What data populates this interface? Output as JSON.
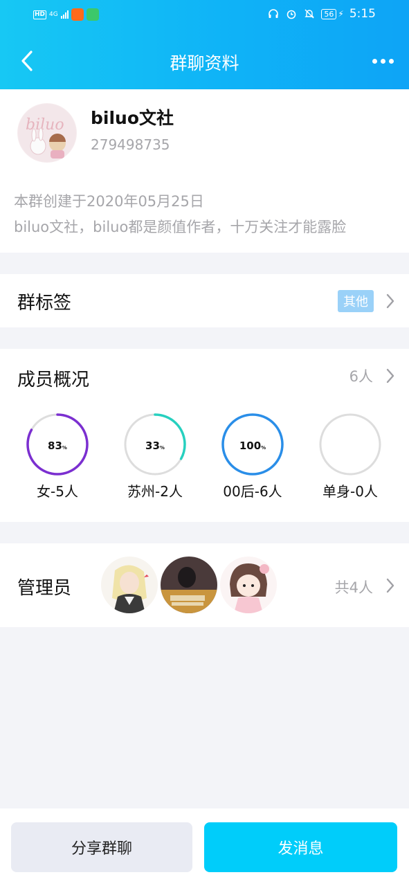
{
  "status_bar": {
    "left_badges": [
      "HD",
      "4G"
    ],
    "time": "5:15",
    "battery": "56"
  },
  "nav": {
    "title": "群聊资料",
    "back_icon": "chevron-left-icon",
    "more_icon": "more-dots-icon"
  },
  "group": {
    "name": "biluo文社",
    "id": "279498735",
    "avatar_text": "biluo",
    "created": "本群创建于2020年05月25日",
    "description": "biluo文社，biluo都是颜值作者，十万关注才能露脸"
  },
  "tags_row": {
    "label": "群标签",
    "tag": "其他"
  },
  "members": {
    "label": "成员概况",
    "count": "6人",
    "stats": [
      {
        "value": "83",
        "unit": "%",
        "label": "女-5人",
        "percent": 83,
        "color": "#7b2fd0"
      },
      {
        "value": "33",
        "unit": "%",
        "label": "苏州-2人",
        "percent": 33,
        "color": "#27d0bf"
      },
      {
        "value": "100",
        "unit": "%",
        "label": "00后-6人",
        "percent": 100,
        "color": "#2a8ee8"
      },
      {
        "value": "",
        "unit": "",
        "label": "单身-0人",
        "percent": 0,
        "color": "#dddddd"
      }
    ]
  },
  "admins": {
    "label": "管理员",
    "total": "共4人",
    "avatars": [
      "admin-avatar-1",
      "admin-avatar-2",
      "admin-avatar-3"
    ]
  },
  "actions": {
    "share": "分享群聊",
    "send": "发消息"
  },
  "colors": {
    "header_start": "#17c8f4",
    "header_end": "#0ea4f6",
    "send_button": "#00cdfa",
    "tag_badge": "#9ad1f8"
  }
}
